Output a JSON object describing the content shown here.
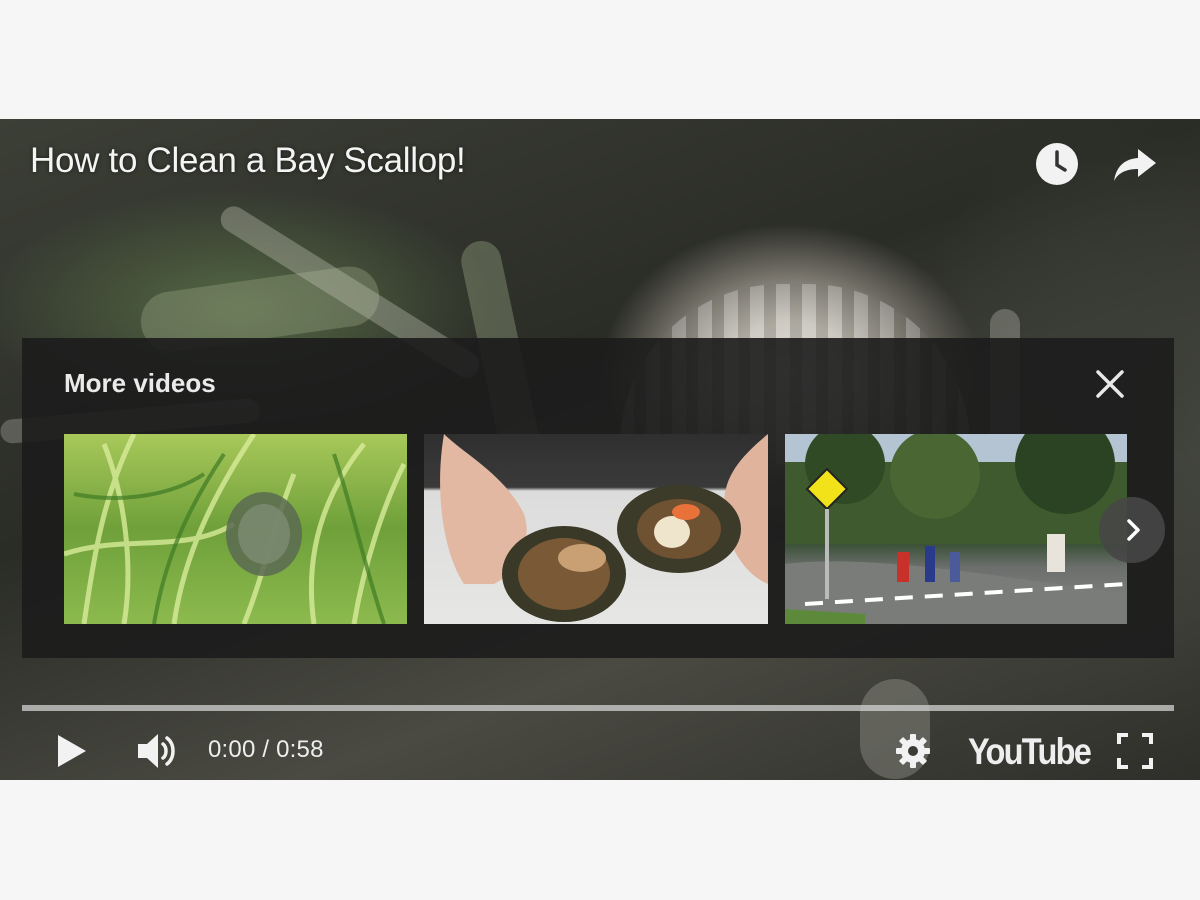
{
  "video": {
    "title": "How to Clean a Bay Scallop!"
  },
  "top_actions": {
    "watch_later_icon": "clock-icon",
    "share_icon": "share-arrow-icon"
  },
  "more_videos": {
    "heading": "More videos",
    "close_icon": "close-icon",
    "next_icon": "chevron-right-icon",
    "thumbnails": [
      {
        "subject": "scallop-in-seagrass"
      },
      {
        "subject": "hands-opening-scallop"
      },
      {
        "subject": "crosswalk-street"
      }
    ]
  },
  "controls": {
    "progress": 0,
    "play_icon": "play-icon",
    "volume_icon": "volume-icon",
    "time_display": "0:00 / 0:58",
    "settings_icon": "gear-icon",
    "brand": "YouTube",
    "fullscreen_icon": "fullscreen-icon"
  },
  "colors": {
    "panel_bg": "#1c1c1c",
    "text": "#eeeeee",
    "page_bg": "#f6f6f6"
  }
}
